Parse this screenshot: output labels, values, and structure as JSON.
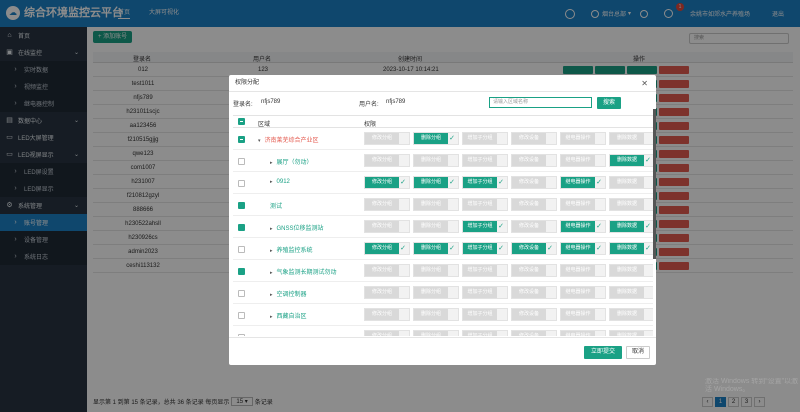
{
  "app": {
    "title": "综合环境监控云平台",
    "logo_icon": "cloud-icon"
  },
  "topnav": {
    "items": [
      "首页",
      "大屏可视化"
    ],
    "active": 0
  },
  "topbar_right": {
    "monitor": "烟台总部",
    "user": "余姚市如郊水产养殖场",
    "logout": "退出",
    "notifications": "1"
  },
  "sidebar": {
    "items": [
      {
        "label": "首页",
        "type": "group"
      },
      {
        "label": "在线监控",
        "type": "group"
      },
      {
        "label": "实时数据",
        "type": "sub"
      },
      {
        "label": "视频监控",
        "type": "sub"
      },
      {
        "label": "继电器控制",
        "type": "sub"
      },
      {
        "label": "数据中心",
        "type": "group"
      },
      {
        "label": "LED大屏管理",
        "type": "group"
      },
      {
        "label": "LED视屏显示",
        "type": "group"
      },
      {
        "label": "LED屏设置",
        "type": "sub"
      },
      {
        "label": "LED屏显示",
        "type": "sub"
      },
      {
        "label": "系统管理",
        "type": "group"
      },
      {
        "label": "账号管理",
        "type": "sub"
      },
      {
        "label": "设备管理",
        "type": "sub"
      },
      {
        "label": "系统日志",
        "type": "sub"
      }
    ]
  },
  "main": {
    "add_button": "添加账号",
    "search_placeholder": "搜索",
    "columns": [
      "登录名",
      "用户名",
      "创建时间",
      "操作"
    ],
    "rows": [
      {
        "login": "012",
        "username": "123",
        "created": "2023-10-17 10:14:21"
      },
      {
        "login": "test1011"
      },
      {
        "login": "nfjs789"
      },
      {
        "login": "h231011scjc"
      },
      {
        "login": "aa123456"
      },
      {
        "login": "f210515gjjg"
      },
      {
        "login": "qwe123"
      },
      {
        "login": "com1007"
      },
      {
        "login": "h231007"
      },
      {
        "login": "f210812gzyl"
      },
      {
        "login": "888666"
      },
      {
        "login": "h230522ahsll"
      },
      {
        "login": "h230926cs"
      },
      {
        "login": "admin2023"
      },
      {
        "login": "ceshi113132"
      }
    ],
    "row_actions": [
      "修改密码",
      "权限分配",
      "修改备注",
      "删除账号"
    ],
    "pager": {
      "summary_prefix": "显示第 1 到第 15 条记录，总共 36 条记录 每页显示",
      "page_size": "15",
      "summary_suffix": "条记录",
      "pages": [
        "1",
        "2",
        "3"
      ],
      "prev": "‹",
      "next": "›"
    }
  },
  "modal": {
    "title": "权限分配",
    "login_label": "登录名:",
    "login_value": "nfjs789",
    "user_label": "用户名:",
    "user_value": "nfjs789",
    "region_placeholder": "请输入区域名称",
    "search_button": "搜索",
    "col_region": "区域",
    "col_perm": "权限",
    "perm_labels": [
      "修改分组",
      "删除分组",
      "增加子分组",
      "修改设备",
      "继电器操作",
      "删除数据"
    ],
    "rows": [
      {
        "name": "济南莱芜综合产业区",
        "indent": 1,
        "arrow": "▾",
        "style": "red",
        "check": "indeterminate",
        "perms": [
          false,
          true,
          false,
          false,
          false,
          false
        ]
      },
      {
        "name": "展厅（勿动）",
        "indent": 2,
        "arrow": "▸",
        "style": "green",
        "check": "off",
        "perms": [
          false,
          false,
          false,
          false,
          false,
          true
        ]
      },
      {
        "name": "0912",
        "indent": 2,
        "arrow": "▸",
        "style": "green",
        "check": "off",
        "perms": [
          true,
          true,
          true,
          false,
          true,
          false
        ]
      },
      {
        "name": "测试",
        "indent": 2,
        "arrow": "",
        "style": "green",
        "check": "on",
        "perms": [
          false,
          false,
          false,
          false,
          false,
          false
        ]
      },
      {
        "name": "GNSS位移监测站",
        "indent": 2,
        "arrow": "▸",
        "style": "green",
        "check": "on",
        "perms": [
          false,
          false,
          true,
          false,
          true,
          true
        ]
      },
      {
        "name": "养殖监控系统",
        "indent": 2,
        "arrow": "▸",
        "style": "green",
        "check": "off",
        "perms": [
          true,
          true,
          true,
          true,
          true,
          true
        ]
      },
      {
        "name": "气象监测长期测试勿动",
        "indent": 2,
        "arrow": "▸",
        "style": "green",
        "check": "on",
        "perms": [
          false,
          false,
          false,
          false,
          false,
          false
        ]
      },
      {
        "name": "空调控制器",
        "indent": 2,
        "arrow": "▸",
        "style": "green",
        "check": "off",
        "perms": [
          false,
          false,
          false,
          false,
          false,
          false
        ]
      },
      {
        "name": "西藏自治区",
        "indent": 2,
        "arrow": "▸",
        "style": "green",
        "check": "off",
        "perms": [
          false,
          false,
          false,
          false,
          false,
          false
        ]
      },
      {
        "name": "",
        "indent": 2,
        "arrow": "",
        "style": "green",
        "check": "off",
        "perms": [
          false,
          false,
          false,
          false,
          false,
          false
        ]
      }
    ],
    "submit": "立即提交",
    "cancel": "取消"
  },
  "watermark": "激活 Windows 转到“设置”以激活 Windows。",
  "colors": {
    "primary": "#1d81c6",
    "accent": "#1aa185",
    "danger": "#e45b50",
    "sidebar": "#283442"
  }
}
